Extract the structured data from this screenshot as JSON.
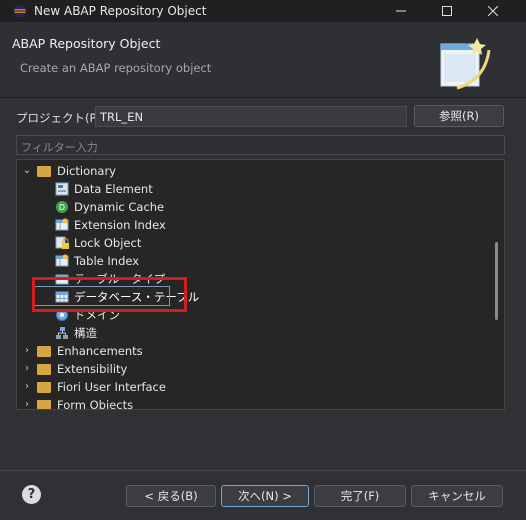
{
  "window": {
    "title": "New ABAP Repository Object"
  },
  "banner": {
    "heading": "ABAP Repository Object",
    "subtitle": "Create an ABAP repository object"
  },
  "project": {
    "label": "プロジェクト(P):",
    "value": "TRL_EN",
    "browse_label": "参照(R)"
  },
  "filter": {
    "placeholder": "フィルター入力"
  },
  "tree": {
    "items": [
      {
        "label": "Dictionary",
        "expanded": true,
        "type": "folder"
      },
      {
        "label": "Data Element",
        "type": "data-element"
      },
      {
        "label": "Dynamic Cache",
        "type": "dynamic-cache"
      },
      {
        "label": "Extension Index",
        "type": "extension-index"
      },
      {
        "label": "Lock Object",
        "type": "lock-object"
      },
      {
        "label": "Table Index",
        "type": "table-index"
      },
      {
        "label": "テーブル・タイプ",
        "type": "table-type"
      },
      {
        "label": "データベース・テーブル",
        "type": "database-table",
        "selected": true
      },
      {
        "label": "ドメイン",
        "type": "domain"
      },
      {
        "label": "構造",
        "type": "structure"
      },
      {
        "label": "Enhancements",
        "type": "folder",
        "expanded": false
      },
      {
        "label": "Extensibility",
        "type": "folder",
        "expanded": false
      },
      {
        "label": "Fiori User Interface",
        "type": "folder",
        "expanded": false
      },
      {
        "label": "Form Objects",
        "type": "folder",
        "expanded": false
      }
    ]
  },
  "buttons": {
    "back": "< 戻る(B)",
    "next": "次へ(N) >",
    "finish": "完了(F)",
    "cancel": "キャンセル"
  },
  "colors": {
    "highlight": "#d11f1f",
    "selection": "#3a4e63",
    "accent": "#6fa8dc"
  }
}
